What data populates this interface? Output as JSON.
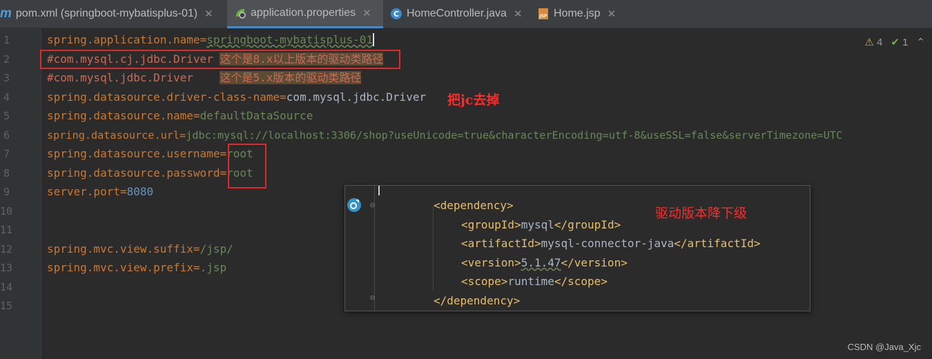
{
  "tabs": [
    {
      "label": "pom.xml (springboot-mybatisplus-01)",
      "icon": "maven-icon"
    },
    {
      "label": "application.properties",
      "icon": "spring-properties-icon",
      "active": true
    },
    {
      "label": "HomeController.java",
      "icon": "java-class-icon"
    },
    {
      "label": "Home.jsp",
      "icon": "jsp-file-icon"
    }
  ],
  "inspections": {
    "warnings": "4",
    "checks": "1"
  },
  "line_numbers": [
    "1",
    "2",
    "3",
    "4",
    "5",
    "6",
    "7",
    "8",
    "9",
    "10",
    "11",
    "12",
    "13",
    "14",
    "15"
  ],
  "code": {
    "l1": {
      "key": "spring.application.name",
      "eq": "=",
      "val": "springboot-mybatisplus-01"
    },
    "l2": {
      "comment": "#com.mysql.cj.jdbc.Driver ",
      "note": "这个是8.x以上版本的驱动类路径"
    },
    "l3": {
      "comment": "#com.mysql.jdbc.Driver    ",
      "note": "这个是5.x版本的驱动类路径"
    },
    "l4": {
      "key": "spring.datasource.driver-class-name",
      "eq": "=",
      "val": "com.mysql.jdbc.Driver"
    },
    "l5": {
      "key": "spring.datasource.name",
      "eq": "=",
      "val": "defaultDataSource"
    },
    "l6": {
      "key": "spring.datasource.url",
      "eq": "=",
      "val": "jdbc:mysql://localhost:3306/shop?useUnicode=true&characterEncoding=utf-8&useSSL=false&serverTimezone=UTC"
    },
    "l7": {
      "key": "spring.datasource.username",
      "eq": "=",
      "val": "root"
    },
    "l8": {
      "key": "spring.datasource.password",
      "eq": "=",
      "val": "root"
    },
    "l9": {
      "key": "server.port",
      "eq": "=",
      "val": "8080"
    },
    "l12": {
      "key": "spring.mvc.view.suffix",
      "eq": "=",
      "val": "/jsp/"
    },
    "l13": {
      "key": "spring.mvc.view.prefix",
      "eq": "=",
      "val": ".jsp"
    }
  },
  "annotations": {
    "remove_jc": "把jc去掉",
    "downgrade_driver": "驱动版本降下级"
  },
  "popup": {
    "lines": [
      {
        "open": "<dependency>",
        "text": "",
        "close": ""
      },
      {
        "open": "<groupId>",
        "text": "mysql",
        "close": "</groupId>"
      },
      {
        "open": "<artifactId>",
        "text": "mysql-connector-java",
        "close": "</artifactId>"
      },
      {
        "open": "<version>",
        "text": "5.1.47",
        "close": "</version>"
      },
      {
        "open": "<scope>",
        "text": "runtime",
        "close": "</scope>"
      },
      {
        "open": "</dependency>",
        "text": "",
        "close": ""
      }
    ]
  },
  "watermark": "CSDN @Java_Xjc",
  "colors": {
    "keyword": "#cc7832",
    "value": "#6a8759",
    "comment": "#cc6a55",
    "annotation": "#ff2a2a",
    "tag": "#e8bf6a"
  }
}
